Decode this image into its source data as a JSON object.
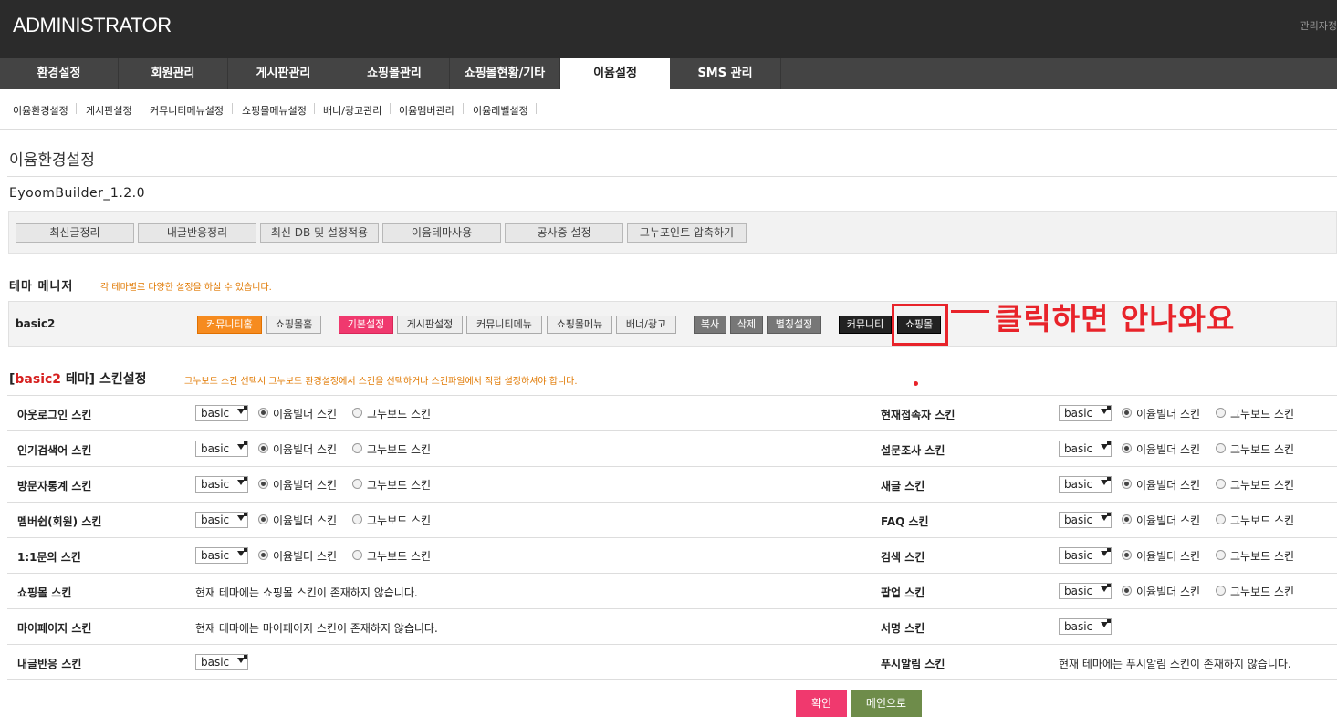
{
  "header": {
    "logo": "ADMINISTRATOR",
    "admin_link": "관리자정"
  },
  "gnb": {
    "tabs": [
      "환경설정",
      "회원관리",
      "게시판관리",
      "쇼핑몰관리",
      "쇼핑몰현황/기타",
      "이윰설정",
      "SMS 관리"
    ],
    "active": "이윰설정"
  },
  "lnb": {
    "items": [
      "이윰환경설정",
      "게시판설정",
      "커뮤니티메뉴설정",
      "쇼핑몰메뉴설정",
      "배너/광고관리",
      "이윰멤버관리",
      "이윰레벨설정"
    ]
  },
  "page": {
    "title": "이윰환경설정",
    "version": "EyoomBuilder_1.2.0"
  },
  "actions": [
    "최신글정리",
    "내글반응정리",
    "최신 DB 및 설정적용",
    "이윰테마사용",
    "공사중 설정",
    "그누포인트 압축하기"
  ],
  "theme_manager": {
    "title": "테마 메니저",
    "desc": "각 테마별로 다양한 설정을 하실 수 있습니다.",
    "theme_name": "basic2",
    "buttons": {
      "community_home": "커뮤니티홈",
      "shop_home": "쇼핑몰홈",
      "basic_setting": "기본설정",
      "board_setting": "게시판설정",
      "community_menu": "커뮤니티메뉴",
      "shop_menu": "쇼핑몰메뉴",
      "banner_ad": "배너/광고",
      "copy": "복사",
      "delete": "삭제",
      "alias_setting": "별칭설정",
      "community": "커뮤니티",
      "shop": "쇼핑몰"
    }
  },
  "annotation": {
    "text": "클릭하면 안나와요",
    "color": "#e8232a"
  },
  "skin": {
    "title_prefix": "[",
    "title_theme": "basic2",
    "title_suffix": " 테마] 스킨설정",
    "desc": "그누보드 스킨 선택시 그누보드 환경설정에서 스킨을 선택하거나 스킨파일에서 직접 설정하셔야 합니다.",
    "option_eyoom": "이윰빌더 스킨",
    "option_gnu": "그누보드 스킨",
    "select_value": "basic",
    "left": [
      {
        "label": "아웃로그인 스킨",
        "type": "select-radio"
      },
      {
        "label": "인기검색어 스킨",
        "type": "select-radio"
      },
      {
        "label": "방문자통계 스킨",
        "type": "select-radio"
      },
      {
        "label": "멤버쉽(회원) 스킨",
        "type": "select-radio"
      },
      {
        "label": "1:1문의 스킨",
        "type": "select-radio"
      },
      {
        "label": "쇼핑몰 스킨",
        "type": "text",
        "text": "현재 테마에는 쇼핑몰 스킨이 존재하지 않습니다."
      },
      {
        "label": "마이페이지 스킨",
        "type": "text",
        "text": "현재 테마에는 마이페이지 스킨이 존재하지 않습니다."
      },
      {
        "label": "내글반응 스킨",
        "type": "select"
      }
    ],
    "right": [
      {
        "label": "현재접속자 스킨",
        "type": "select-radio"
      },
      {
        "label": "설문조사 스킨",
        "type": "select-radio"
      },
      {
        "label": "새글 스킨",
        "type": "select-radio"
      },
      {
        "label": "FAQ 스킨",
        "type": "select-radio"
      },
      {
        "label": "검색 스킨",
        "type": "select-radio"
      },
      {
        "label": "팝업 스킨",
        "type": "select-radio"
      },
      {
        "label": "서명 스킨",
        "type": "select"
      },
      {
        "label": "푸시알림 스킨",
        "type": "text",
        "text": "현재 테마에는 푸시알림 스킨이 존재하지 않습니다."
      }
    ]
  },
  "footer_buttons": {
    "confirm": "확인",
    "main": "메인으로"
  }
}
